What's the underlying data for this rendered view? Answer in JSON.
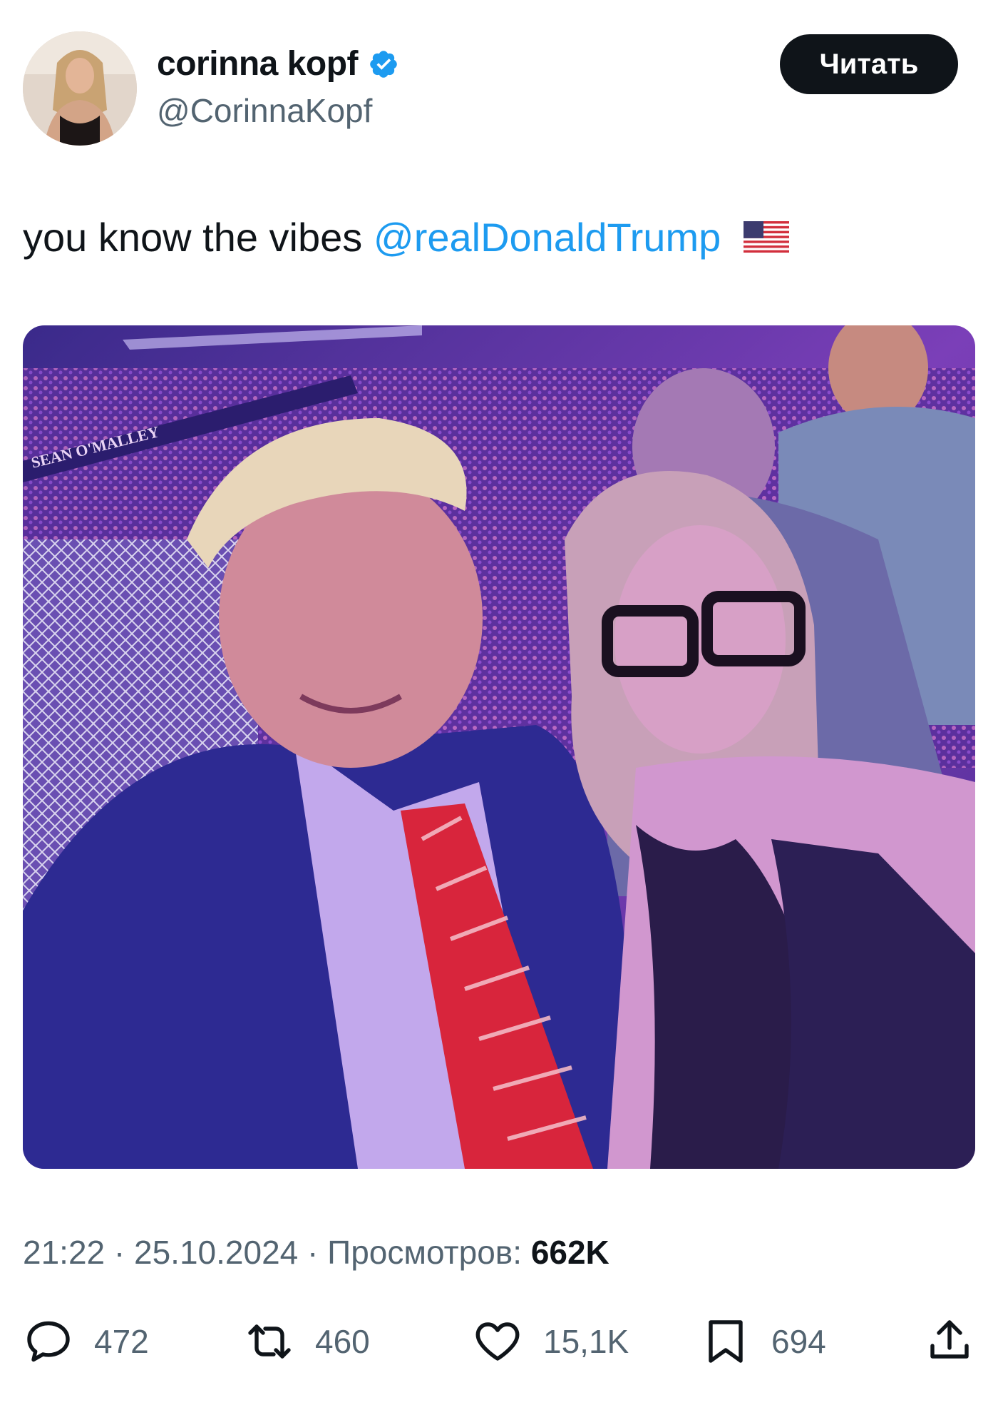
{
  "author": {
    "display_name": "corinna kopf",
    "handle": "@CorinnaKopf",
    "verified_icon": "verified-badge-icon",
    "verified_color": "#1d9bf0"
  },
  "follow_button": {
    "label": "Читать"
  },
  "tweet": {
    "text": "you know the vibes",
    "mention": "@realDonaldTrump",
    "emoji_icon": "us-flag-icon"
  },
  "photo": {
    "banner_text": "SEAN O'MALLEY"
  },
  "meta": {
    "time": "21:22",
    "separator": " · ",
    "date": "25.10.2024",
    "views_label": "Просмотров:",
    "views_count": "662K"
  },
  "actions": {
    "reply_count": "472",
    "retweet_count": "460",
    "like_count": "15,1K",
    "bookmark_count": "694"
  },
  "colors": {
    "accent": "#1d9bf0",
    "text_primary": "#0f1419",
    "text_secondary": "#536471"
  }
}
